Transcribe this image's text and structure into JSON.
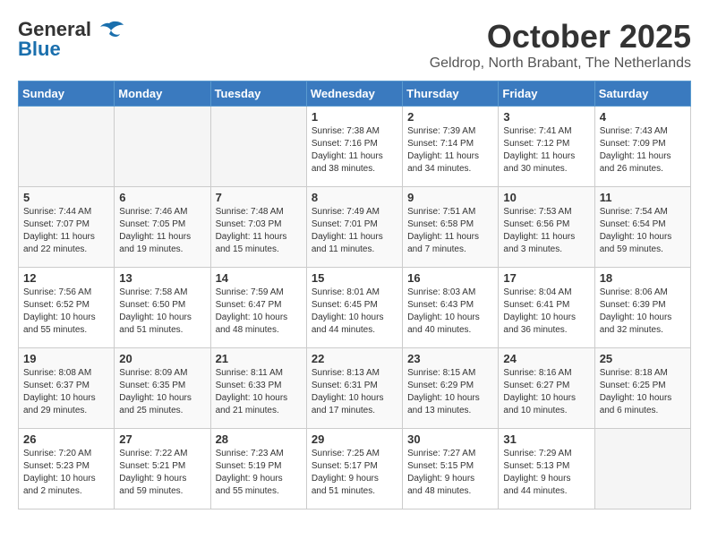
{
  "logo": {
    "part1": "General",
    "part2": "Blue"
  },
  "header": {
    "month": "October 2025",
    "location": "Geldrop, North Brabant, The Netherlands"
  },
  "weekdays": [
    "Sunday",
    "Monday",
    "Tuesday",
    "Wednesday",
    "Thursday",
    "Friday",
    "Saturday"
  ],
  "weeks": [
    [
      {
        "num": "",
        "info": ""
      },
      {
        "num": "",
        "info": ""
      },
      {
        "num": "",
        "info": ""
      },
      {
        "num": "1",
        "info": "Sunrise: 7:38 AM\nSunset: 7:16 PM\nDaylight: 11 hours\nand 38 minutes."
      },
      {
        "num": "2",
        "info": "Sunrise: 7:39 AM\nSunset: 7:14 PM\nDaylight: 11 hours\nand 34 minutes."
      },
      {
        "num": "3",
        "info": "Sunrise: 7:41 AM\nSunset: 7:12 PM\nDaylight: 11 hours\nand 30 minutes."
      },
      {
        "num": "4",
        "info": "Sunrise: 7:43 AM\nSunset: 7:09 PM\nDaylight: 11 hours\nand 26 minutes."
      }
    ],
    [
      {
        "num": "5",
        "info": "Sunrise: 7:44 AM\nSunset: 7:07 PM\nDaylight: 11 hours\nand 22 minutes."
      },
      {
        "num": "6",
        "info": "Sunrise: 7:46 AM\nSunset: 7:05 PM\nDaylight: 11 hours\nand 19 minutes."
      },
      {
        "num": "7",
        "info": "Sunrise: 7:48 AM\nSunset: 7:03 PM\nDaylight: 11 hours\nand 15 minutes."
      },
      {
        "num": "8",
        "info": "Sunrise: 7:49 AM\nSunset: 7:01 PM\nDaylight: 11 hours\nand 11 minutes."
      },
      {
        "num": "9",
        "info": "Sunrise: 7:51 AM\nSunset: 6:58 PM\nDaylight: 11 hours\nand 7 minutes."
      },
      {
        "num": "10",
        "info": "Sunrise: 7:53 AM\nSunset: 6:56 PM\nDaylight: 11 hours\nand 3 minutes."
      },
      {
        "num": "11",
        "info": "Sunrise: 7:54 AM\nSunset: 6:54 PM\nDaylight: 10 hours\nand 59 minutes."
      }
    ],
    [
      {
        "num": "12",
        "info": "Sunrise: 7:56 AM\nSunset: 6:52 PM\nDaylight: 10 hours\nand 55 minutes."
      },
      {
        "num": "13",
        "info": "Sunrise: 7:58 AM\nSunset: 6:50 PM\nDaylight: 10 hours\nand 51 minutes."
      },
      {
        "num": "14",
        "info": "Sunrise: 7:59 AM\nSunset: 6:47 PM\nDaylight: 10 hours\nand 48 minutes."
      },
      {
        "num": "15",
        "info": "Sunrise: 8:01 AM\nSunset: 6:45 PM\nDaylight: 10 hours\nand 44 minutes."
      },
      {
        "num": "16",
        "info": "Sunrise: 8:03 AM\nSunset: 6:43 PM\nDaylight: 10 hours\nand 40 minutes."
      },
      {
        "num": "17",
        "info": "Sunrise: 8:04 AM\nSunset: 6:41 PM\nDaylight: 10 hours\nand 36 minutes."
      },
      {
        "num": "18",
        "info": "Sunrise: 8:06 AM\nSunset: 6:39 PM\nDaylight: 10 hours\nand 32 minutes."
      }
    ],
    [
      {
        "num": "19",
        "info": "Sunrise: 8:08 AM\nSunset: 6:37 PM\nDaylight: 10 hours\nand 29 minutes."
      },
      {
        "num": "20",
        "info": "Sunrise: 8:09 AM\nSunset: 6:35 PM\nDaylight: 10 hours\nand 25 minutes."
      },
      {
        "num": "21",
        "info": "Sunrise: 8:11 AM\nSunset: 6:33 PM\nDaylight: 10 hours\nand 21 minutes."
      },
      {
        "num": "22",
        "info": "Sunrise: 8:13 AM\nSunset: 6:31 PM\nDaylight: 10 hours\nand 17 minutes."
      },
      {
        "num": "23",
        "info": "Sunrise: 8:15 AM\nSunset: 6:29 PM\nDaylight: 10 hours\nand 13 minutes."
      },
      {
        "num": "24",
        "info": "Sunrise: 8:16 AM\nSunset: 6:27 PM\nDaylight: 10 hours\nand 10 minutes."
      },
      {
        "num": "25",
        "info": "Sunrise: 8:18 AM\nSunset: 6:25 PM\nDaylight: 10 hours\nand 6 minutes."
      }
    ],
    [
      {
        "num": "26",
        "info": "Sunrise: 7:20 AM\nSunset: 5:23 PM\nDaylight: 10 hours\nand 2 minutes."
      },
      {
        "num": "27",
        "info": "Sunrise: 7:22 AM\nSunset: 5:21 PM\nDaylight: 9 hours\nand 59 minutes."
      },
      {
        "num": "28",
        "info": "Sunrise: 7:23 AM\nSunset: 5:19 PM\nDaylight: 9 hours\nand 55 minutes."
      },
      {
        "num": "29",
        "info": "Sunrise: 7:25 AM\nSunset: 5:17 PM\nDaylight: 9 hours\nand 51 minutes."
      },
      {
        "num": "30",
        "info": "Sunrise: 7:27 AM\nSunset: 5:15 PM\nDaylight: 9 hours\nand 48 minutes."
      },
      {
        "num": "31",
        "info": "Sunrise: 7:29 AM\nSunset: 5:13 PM\nDaylight: 9 hours\nand 44 minutes."
      },
      {
        "num": "",
        "info": ""
      }
    ]
  ]
}
